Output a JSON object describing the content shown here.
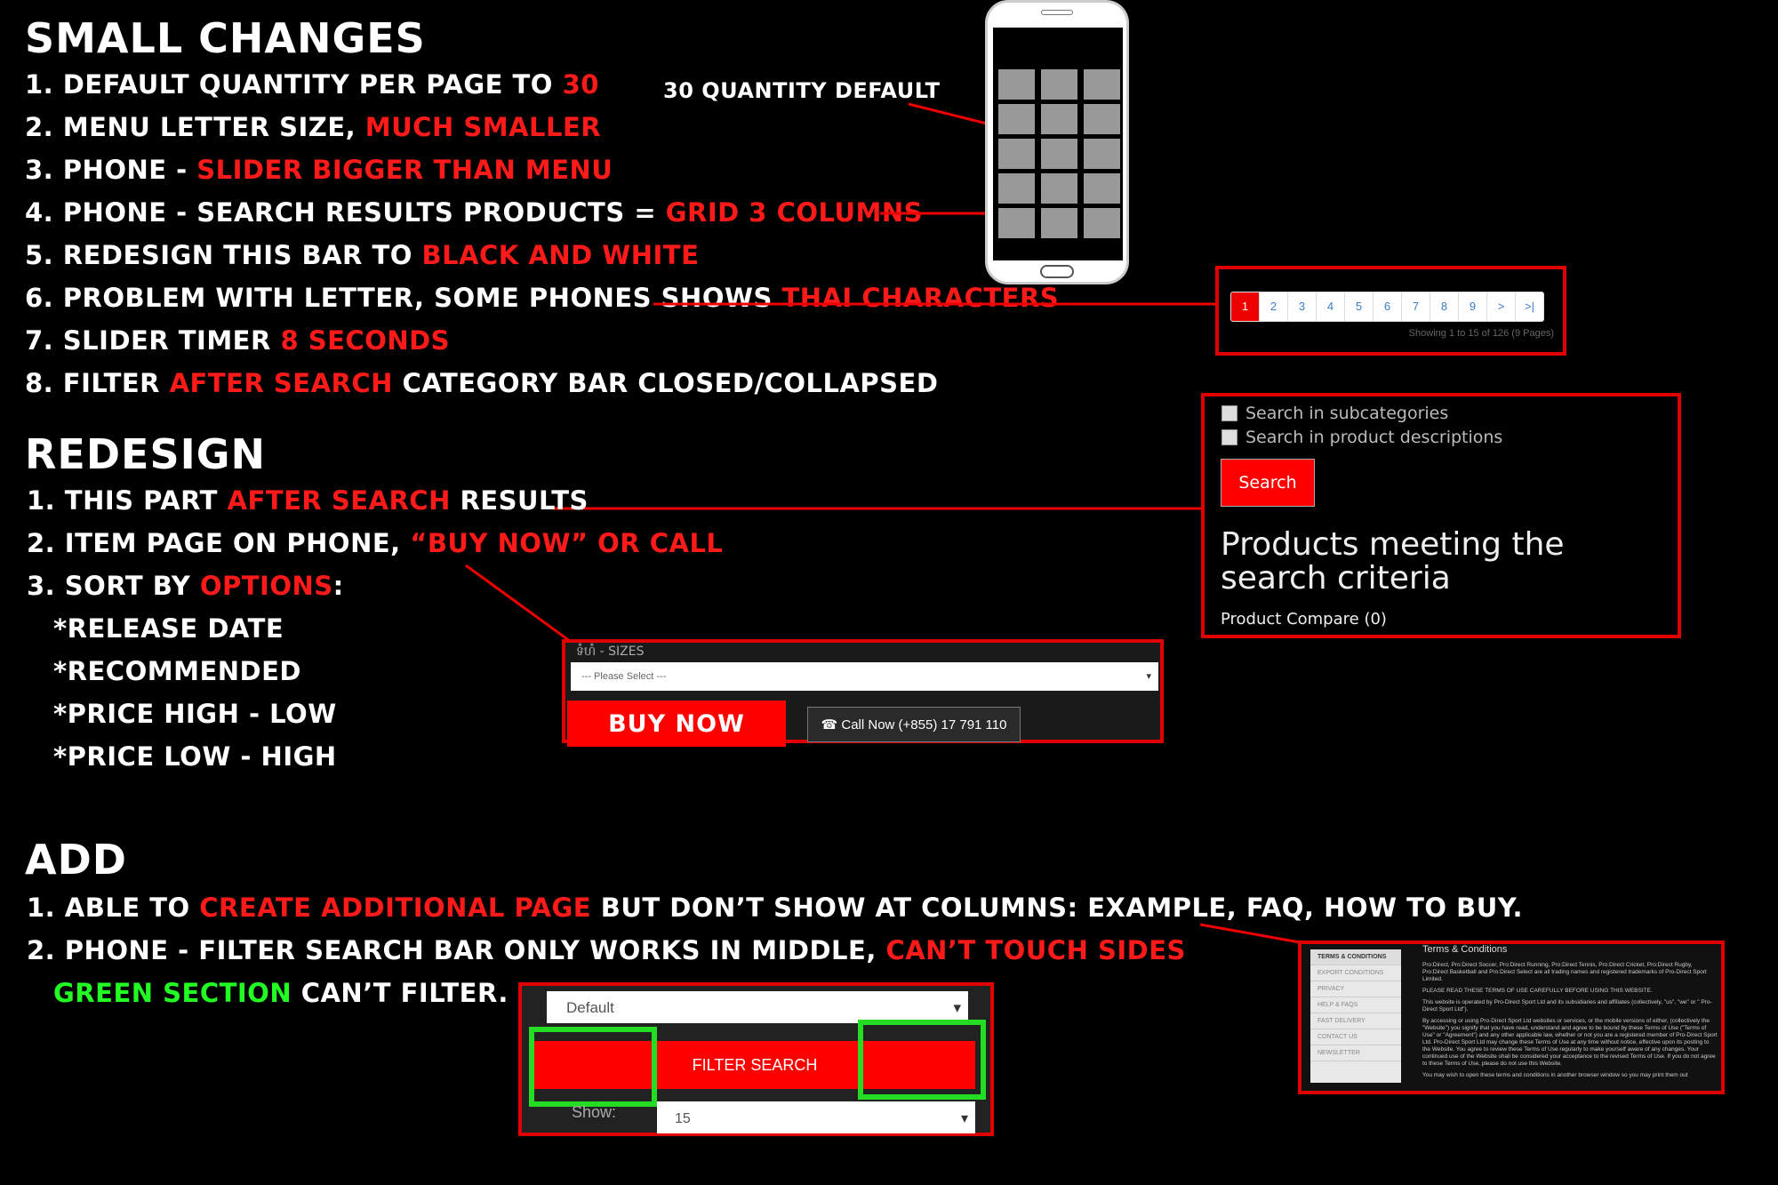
{
  "small_changes": {
    "title": "SMALL CHANGES",
    "items": [
      {
        "w": "1. DEFAULT QUANTITY PER PAGE TO ",
        "r": "30",
        "t": ""
      },
      {
        "w": "2. MENU LETTER SIZE, ",
        "r": "MUCH SMALLER",
        "t": ""
      },
      {
        "w": "3. PHONE - ",
        "r": "SLIDER BIGGER THAN MENU",
        "t": ""
      },
      {
        "w": "4. PHONE - SEARCH RESULTS PRODUCTS = ",
        "r": "GRID 3 COLUMNS",
        "t": ""
      },
      {
        "w": "5. REDESIGN THIS BAR TO ",
        "r": "BLACK AND WHITE",
        "t": ""
      },
      {
        "w": "6. PROBLEM WITH LETTER, SOME PHONES SHOWS ",
        "r": "THAI CHARACTERS",
        "t": ""
      },
      {
        "w": "7. SLIDER TIMER ",
        "r": "8 SECONDS",
        "t": ""
      },
      {
        "w": "8. FILTER ",
        "r": "AFTER SEARCH",
        "t": " CATEGORY BAR CLOSED/COLLAPSED"
      }
    ]
  },
  "redesign": {
    "title": "REDESIGN",
    "items": [
      {
        "w": "1. THIS PART ",
        "r": "AFTER SEARCH",
        "t": " RESULTS"
      },
      {
        "w": "2. ITEM PAGE ON PHONE, ",
        "r": "“BUY NOW” OR CALL",
        "t": ""
      },
      {
        "w": "3. SORT BY ",
        "r": "OPTIONS",
        "t": ":"
      }
    ],
    "sort_options": [
      "*RELEASE DATE",
      "*RECOMMENDED",
      "*PRICE HIGH - LOW",
      "*PRICE LOW - HIGH"
    ]
  },
  "add": {
    "title": "ADD",
    "item1": {
      "w": "1. ABLE TO ",
      "r": "CREATE ADDITIONAL PAGE",
      "t": " BUT DON’T SHOW AT COLUMNS: EXAMPLE, FAQ, HOW TO BUY."
    },
    "item2": {
      "w": "2. PHONE - FILTER SEARCH BAR ONLY WORKS IN MIDDLE, ",
      "r": "CAN’T TOUCH SIDES"
    },
    "item2b": {
      "g": "GREEN SECTION",
      "t": " CAN’T FILTER."
    }
  },
  "phone_label": "30 QUANTITY DEFAULT",
  "pagination": {
    "pages": [
      "1",
      "2",
      "3",
      "4",
      "5",
      "6",
      "7",
      "8",
      "9",
      ">",
      ">|"
    ],
    "active": "1",
    "summary": "Showing 1 to 15 of 126 (9 Pages)"
  },
  "search_panel": {
    "check1": "Search in subcategories",
    "check2": "Search in product descriptions",
    "button": "Search",
    "heading": "Products meeting the search criteria",
    "compare": "Product Compare (0)"
  },
  "buy_panel": {
    "sizes_label": "ទំហំ - SIZES",
    "select_placeholder": "--- Please Select ---",
    "buy_now": "BUY NOW",
    "call_now": "☎ Call Now (+855) 17 791 110"
  },
  "terms_panel": {
    "title": "Terms & Conditions",
    "sidebar": [
      "TERMS & CONDITIONS",
      "EXPORT CONDITIONS",
      "PRIVACY",
      "HELP & FAQS",
      "FAST DELIVERY",
      "CONTACT US",
      "NEWSLETTER"
    ]
  },
  "filter_panel": {
    "sort_value": "Default",
    "filter_label": "FILTER SEARCH",
    "show_label": "Show:",
    "show_value": "15"
  },
  "colors": {
    "accent_red": "#ff1a1a",
    "green": "#22ff22",
    "box_red": "#e00000"
  }
}
